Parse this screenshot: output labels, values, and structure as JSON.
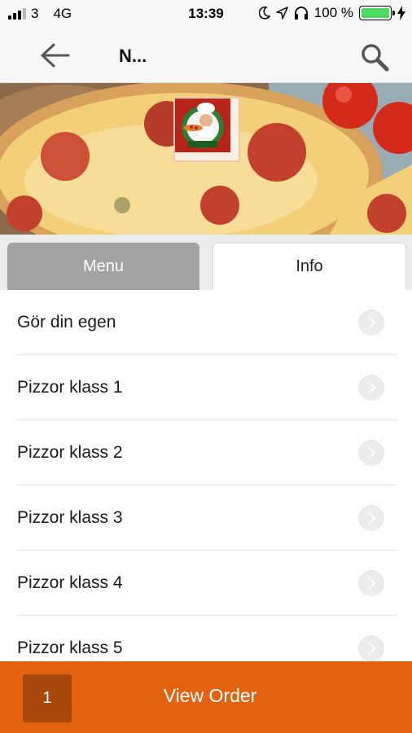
{
  "status_bar": {
    "carrier": "3",
    "network": "4G",
    "time": "13:39",
    "battery_percent": "100 %",
    "icons": [
      "signal-icon",
      "moon-icon",
      "location-icon",
      "headphones-icon",
      "battery-icon",
      "charging-icon"
    ]
  },
  "nav": {
    "title": "N...",
    "back_icon": "back-arrow-icon",
    "search_icon": "search-icon"
  },
  "hero": {
    "image": "pizza-photo",
    "logo_text": "PIZZA"
  },
  "tabs": [
    {
      "label": "Menu",
      "active": true
    },
    {
      "label": "Info",
      "active": false
    }
  ],
  "menu_items": [
    {
      "label": "Gör din egen"
    },
    {
      "label": "Pizzor klass 1"
    },
    {
      "label": "Pizzor klass 2"
    },
    {
      "label": "Pizzor klass 3"
    },
    {
      "label": "Pizzor klass 4"
    },
    {
      "label": "Pizzor klass 5"
    }
  ],
  "bottom_bar": {
    "item_count": "1",
    "view_order_label": "View Order"
  },
  "colors": {
    "accent": "#e2620f",
    "accent_dark": "#a9480d",
    "tab_active": "#a3a3a3"
  }
}
